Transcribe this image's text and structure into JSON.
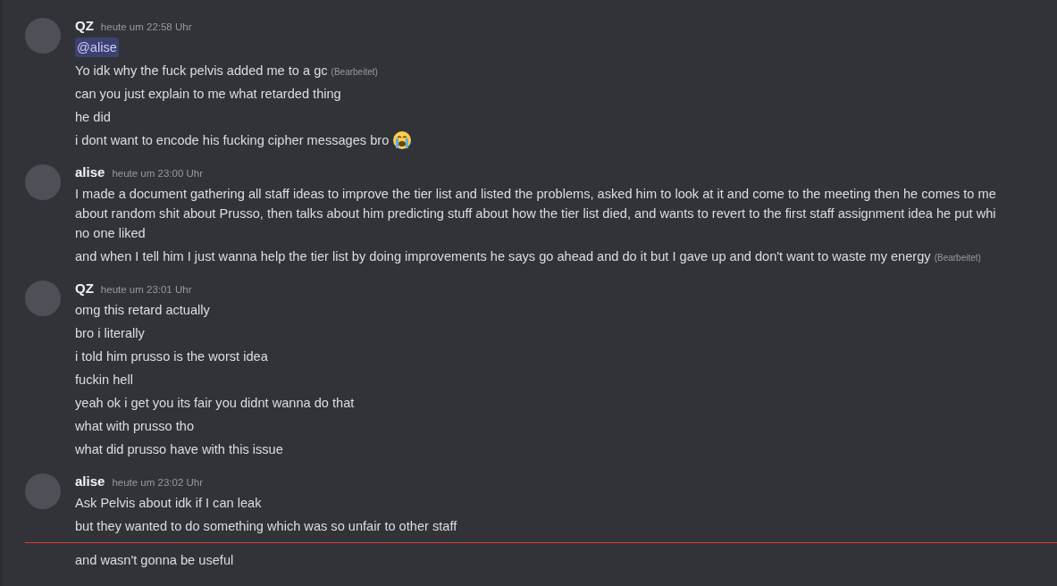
{
  "chat": {
    "groups": [
      {
        "author": "QZ",
        "timestamp": "heute um 22:58 Uhr",
        "messages": [
          {
            "kind": "mention",
            "lines": [
              "@alise"
            ]
          },
          {
            "kind": "text",
            "lines": [
              "Yo idk why the fuck pelvis added me to a gc"
            ],
            "edited_label": "(Bearbeitet)"
          },
          {
            "kind": "text",
            "lines": [
              "can you just explain to me what retarded thing"
            ]
          },
          {
            "kind": "text",
            "lines": [
              "he did"
            ]
          },
          {
            "kind": "text",
            "lines": [
              "i dont want to encode his fucking cipher messages bro"
            ],
            "emoji": true
          }
        ]
      },
      {
        "author": "alise",
        "timestamp": "heute um 23:00 Uhr",
        "messages": [
          {
            "kind": "text",
            "lines": [
              "I made a document gathering all staff ideas to improve the tier list and listed the problems, asked him to look at it and come to the meeting then he comes to me",
              "about random shit about Prusso, then talks about him predicting stuff about how the tier list died, and wants to revert to the first staff assignment idea he put whi",
              "no one liked"
            ]
          },
          {
            "kind": "text",
            "lines": [
              "and when I tell him I just wanna help the tier list by doing improvements he says go ahead and do it but I gave up and don't want to waste my energy"
            ],
            "edited_label": "(Bearbeitet)"
          }
        ]
      },
      {
        "author": "QZ",
        "timestamp": "heute um 23:01 Uhr",
        "messages": [
          {
            "kind": "text",
            "lines": [
              "omg this retard actually"
            ]
          },
          {
            "kind": "text",
            "lines": [
              "bro i literally"
            ]
          },
          {
            "kind": "text",
            "lines": [
              "i told him prusso is the worst idea"
            ]
          },
          {
            "kind": "text",
            "lines": [
              "fuckin hell"
            ]
          },
          {
            "kind": "text",
            "lines": [
              "yeah ok i get you its fair you didnt wanna do that"
            ]
          },
          {
            "kind": "text",
            "lines": [
              "what with prusso tho"
            ]
          },
          {
            "kind": "text",
            "lines": [
              "what did prusso have with this issue"
            ]
          }
        ]
      },
      {
        "author": "alise",
        "timestamp": "heute um 23:02 Uhr",
        "messages": [
          {
            "kind": "text",
            "lines": [
              "Ask Pelvis about idk if I can leak"
            ]
          },
          {
            "kind": "text",
            "lines": [
              "but they wanted to do something which was so unfair to other staff"
            ]
          },
          {
            "kind": "text",
            "lines": [
              "and wasn't gonna be useful"
            ],
            "divider_before": true
          }
        ]
      }
    ]
  }
}
